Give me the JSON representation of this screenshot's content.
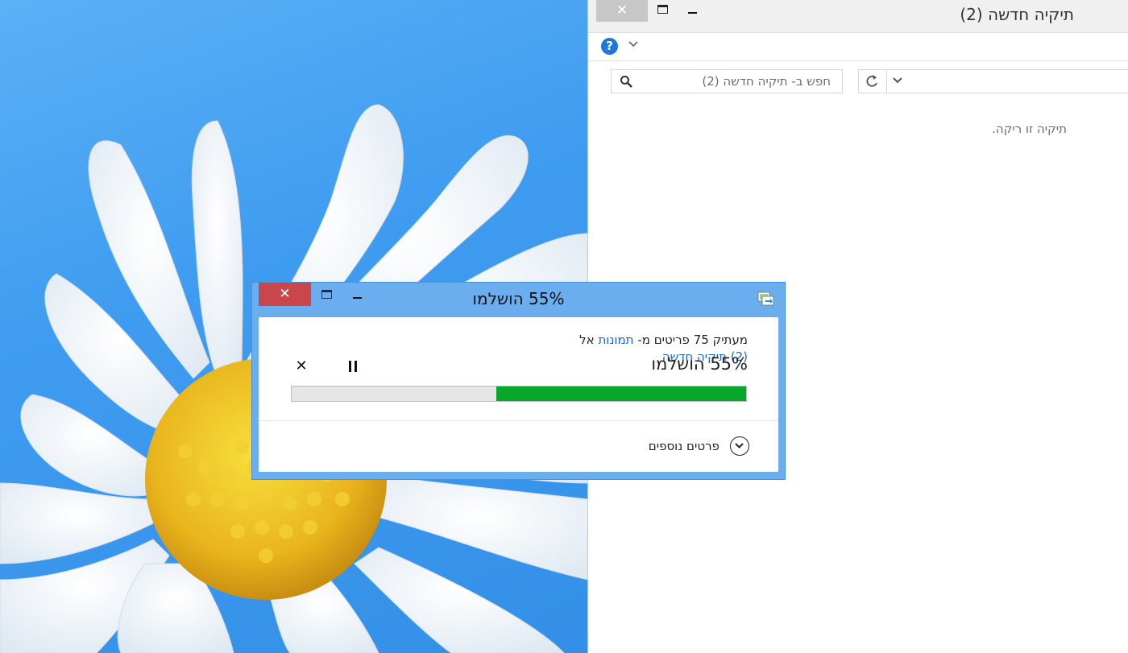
{
  "explorer": {
    "title": "תיקיה חדשה (2)",
    "close_glyph": "✕",
    "search_placeholder": "חפש ב- תיקיה חדשה (2)",
    "empty_message": "תיקיה זו ריקה."
  },
  "dialog": {
    "title": "55% הושלמו",
    "close_glyph": "✕",
    "copy_prefix": "מעתיק 75 פריטים מ-",
    "source_name": "תמונות",
    "copy_middle": "אל",
    "destination_name": "(2) תיקיה חדשה",
    "percent_label": "55% הושלמו",
    "progress_fraction": 0.55,
    "cancel_glyph": "✕",
    "more_details_label": "פרטים נוספים"
  },
  "colors": {
    "progress_fill": "#06a72a",
    "dialog_frame": "#6aaef0",
    "close_red": "#c9474a",
    "link_blue": "#1f65c4",
    "help_blue": "#1e78d6"
  },
  "icons": {
    "dialog_app": "copy-files-icon",
    "help": "help-icon",
    "search": "search-icon",
    "refresh": "refresh-icon",
    "more_details": "chevron-down-circle-icon"
  }
}
